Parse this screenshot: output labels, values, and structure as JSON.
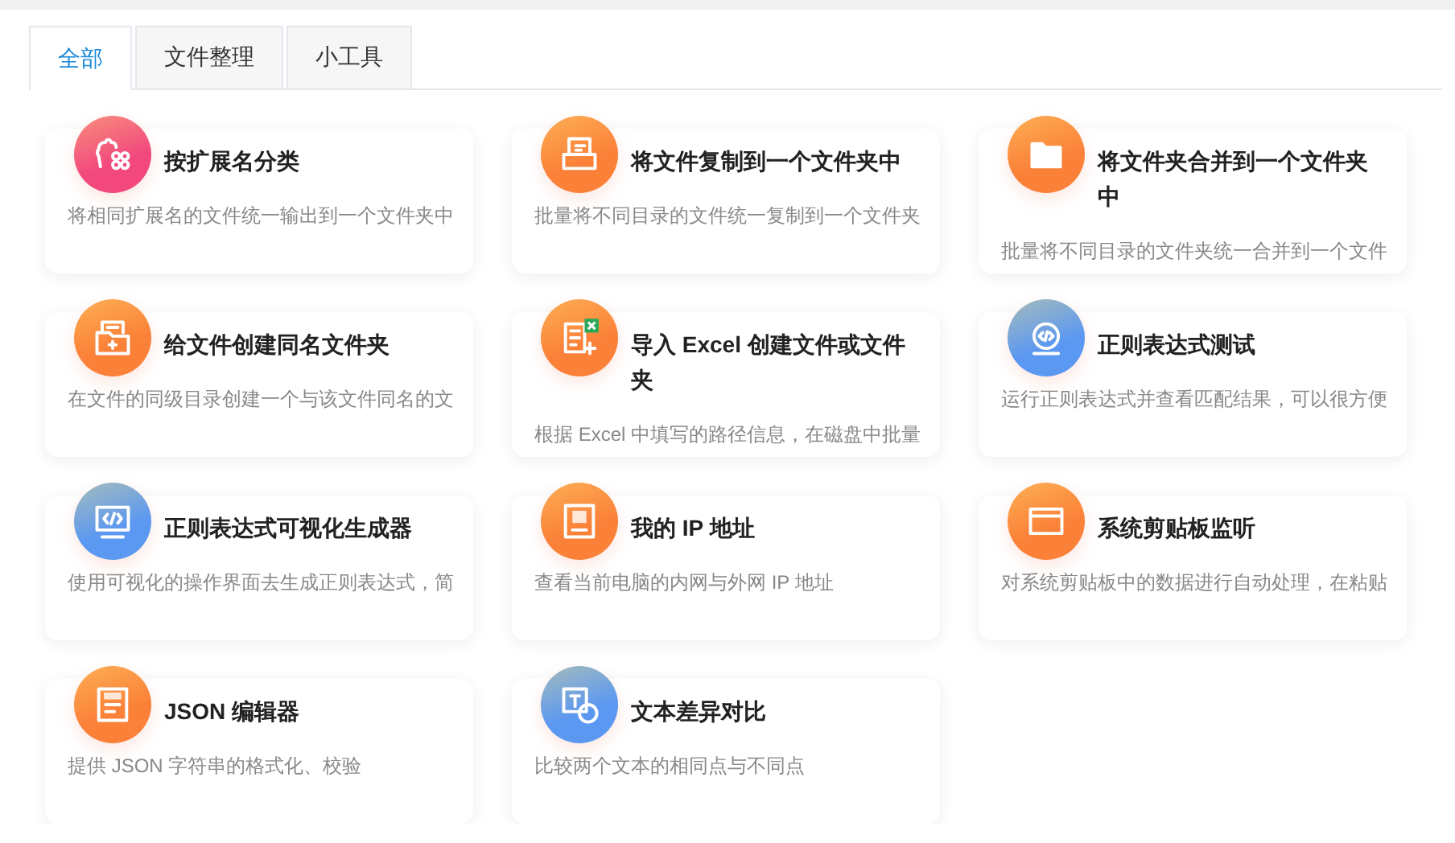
{
  "tabs": [
    {
      "label": "全部",
      "selected": true
    },
    {
      "label": "文件整理",
      "selected": false
    },
    {
      "label": "小工具",
      "selected": false
    }
  ],
  "tools": [
    {
      "title": "按扩展名分类",
      "description": "将相同扩展名的文件统一输出到一个文件夹中",
      "color": "#f2487e"
    },
    {
      "title": "将文件复制到一个文件夹中",
      "description": "批量将不同目录的文件统一复制到一个文件夹",
      "color": "#fb8038"
    },
    {
      "title": "将文件夹合并到一个文件夹中",
      "description": "批量将不同目录的文件夹统一合并到一个文件",
      "color": "#fb8038"
    },
    {
      "title": "给文件创建同名文件夹",
      "description": "在文件的同级目录创建一个与该文件同名的文",
      "color": "#fb8038"
    },
    {
      "title": "导入 Excel 创建文件或文件夹",
      "description": "根据 Excel 中填写的路径信息，在磁盘中批量",
      "color": "#fb8038"
    },
    {
      "title": "正则表达式测试",
      "description": "运行正则表达式并查看匹配结果，可以很方便",
      "color": "#5b98f2"
    },
    {
      "title": "正则表达式可视化生成器",
      "description": "使用可视化的操作界面去生成正则表达式，简",
      "color": "#5b98f2"
    },
    {
      "title": "我的 IP 地址",
      "description": "查看当前电脑的内网与外网 IP 地址",
      "color": "#fb8038"
    },
    {
      "title": "系统剪贴板监听",
      "description": "对系统剪贴板中的数据进行自动处理，在粘贴",
      "color": "#fb8038"
    },
    {
      "title": "JSON 编辑器",
      "description": "提供 JSON 字符串的格式化、校验",
      "color": "#fb8038"
    },
    {
      "title": "文本差异对比",
      "description": "比较两个文本的相同点与不同点",
      "color": "#5b98f2"
    }
  ]
}
